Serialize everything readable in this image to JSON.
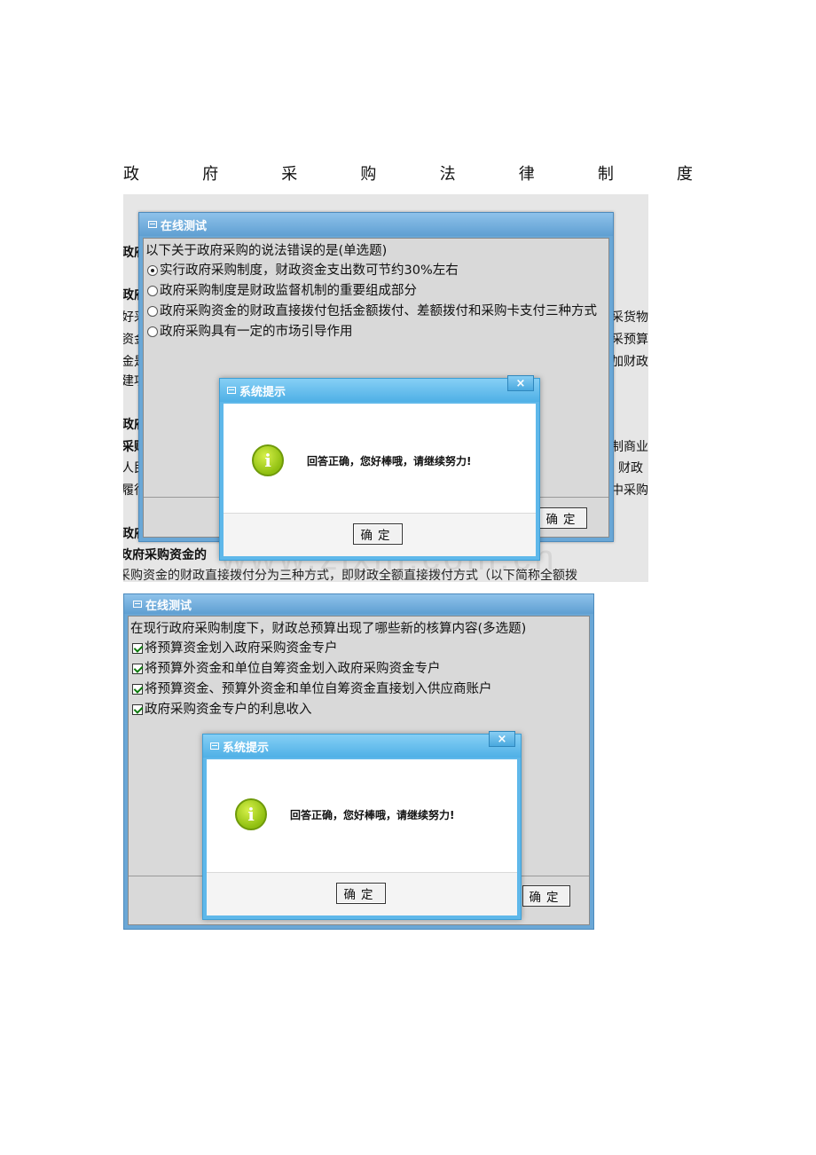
{
  "doc_title": [
    "政",
    "府",
    "采",
    "购",
    "法",
    "律",
    "制",
    "度"
  ],
  "screenshot1": {
    "background_fragments_left": [
      "政府",
      "政府",
      "好采",
      "资金",
      "金是",
      "建项",
      "政府",
      "采购",
      "人民",
      "履行",
      "政府"
    ],
    "background_fragments_right": [
      "采货物",
      "采预算",
      "加财政",
      "制商业",
      "财政",
      "中采购"
    ],
    "background_heading": "政府采购资金的",
    "background_line": "采购资金的财政直接拨付分为三种方式，即财政全额直接拨付方式（以下简称全额拨",
    "quiz": {
      "title": "在线测试",
      "question": "以下关于政府采购的说法错误的是(单选题)",
      "options": [
        {
          "label": "实行政府采购制度，财政资金支出数可节约30%左右",
          "selected": true
        },
        {
          "label": "政府采购制度是财政监督机制的重要组成部分",
          "selected": false
        },
        {
          "label": "政府采购资金的财政直接拨付包括金额拨付、差额拨付和采购卡支付三种方式",
          "selected": false
        },
        {
          "label": "政府采购具有一定的市场引导作用",
          "selected": false
        }
      ],
      "confirm_label": "确定"
    },
    "dialog": {
      "title": "系统提示",
      "close_glyph": "×",
      "icon_glyph": "i",
      "message": "回答正确，您好棒哦，请继续努力!",
      "ok_label": "确定"
    },
    "watermark": "www.zixin.com.cn"
  },
  "screenshot2": {
    "quiz": {
      "title": "在线测试",
      "question": "在现行政府采购制度下，财政总预算出现了哪些新的核算内容(多选题)",
      "options": [
        {
          "label": "将预算资金划入政府采购资金专户",
          "checked": true
        },
        {
          "label": "将预算外资金和单位自筹资金划入政府采购资金专户",
          "checked": true
        },
        {
          "label": "将预算资金、预算外资金和单位自筹资金直接划入供应商账户",
          "checked": true
        },
        {
          "label": "政府采购资金专户的利息收入",
          "checked": true
        }
      ],
      "confirm_label": "确定"
    },
    "dialog": {
      "title": "系统提示",
      "close_glyph": "×",
      "icon_glyph": "i",
      "message": "回答正确，您好棒哦，请继续努力!",
      "ok_label": "确定"
    }
  }
}
